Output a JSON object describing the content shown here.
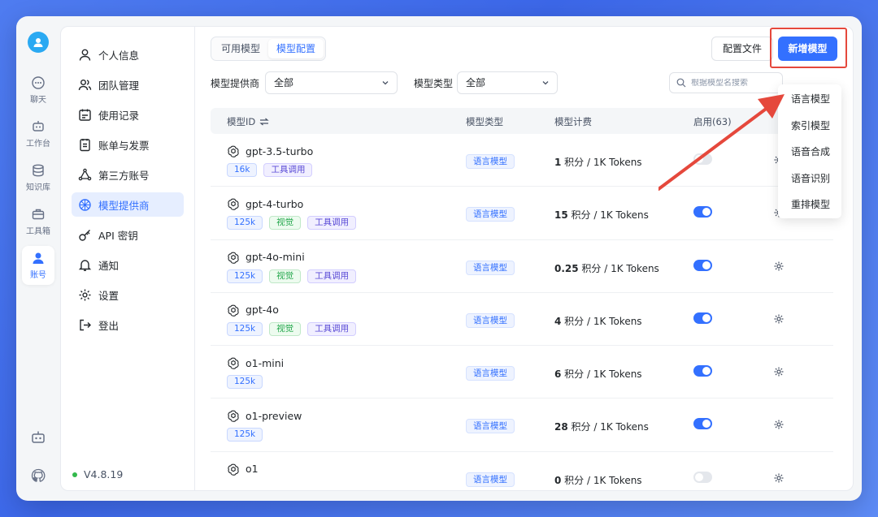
{
  "rail": {
    "items": [
      {
        "label": "聊天",
        "icon": "chat-icon"
      },
      {
        "label": "工作台",
        "icon": "robot-icon"
      },
      {
        "label": "知识库",
        "icon": "database-icon"
      },
      {
        "label": "工具箱",
        "icon": "toolbox-icon"
      },
      {
        "label": "账号",
        "icon": "user-icon"
      }
    ]
  },
  "menu": {
    "items": [
      {
        "label": "个人信息",
        "icon": "user-icon"
      },
      {
        "label": "团队管理",
        "icon": "team-icon"
      },
      {
        "label": "使用记录",
        "icon": "calendar-icon"
      },
      {
        "label": "账单与发票",
        "icon": "bill-icon"
      },
      {
        "label": "第三方账号",
        "icon": "share-icon"
      },
      {
        "label": "模型提供商",
        "icon": "model-icon"
      },
      {
        "label": "API 密钥",
        "icon": "key-icon"
      },
      {
        "label": "通知",
        "icon": "bell-icon"
      },
      {
        "label": "设置",
        "icon": "gear-icon"
      },
      {
        "label": "登出",
        "icon": "logout-icon"
      }
    ],
    "active_index": 5,
    "version": "V4.8.19"
  },
  "tabs": [
    "可用模型",
    "模型配置"
  ],
  "active_tab": 1,
  "buttons": {
    "config": "配置文件",
    "add": "新增模型"
  },
  "filters": {
    "provider_label": "模型提供商",
    "provider_value": "全部",
    "type_label": "模型类型",
    "type_value": "全部",
    "search_placeholder": "根据模型名搜索"
  },
  "table": {
    "headers": {
      "id": "模型ID",
      "type": "模型类型",
      "price": "模型计费",
      "enabled": "启用(63)"
    },
    "rows": [
      {
        "name": "gpt-3.5-turbo",
        "tags": [
          {
            "t": "16k",
            "c": "blue"
          },
          {
            "t": "工具调用",
            "c": "purple"
          }
        ],
        "type": "语言模型",
        "price_num": "1",
        "price_unit": " 积分 / 1K Tokens",
        "enabled": false
      },
      {
        "name": "gpt-4-turbo",
        "tags": [
          {
            "t": "125k",
            "c": "blue"
          },
          {
            "t": "视觉",
            "c": "green"
          },
          {
            "t": "工具调用",
            "c": "purple"
          }
        ],
        "type": "语言模型",
        "price_num": "15",
        "price_unit": " 积分 / 1K Tokens",
        "enabled": true
      },
      {
        "name": "gpt-4o-mini",
        "tags": [
          {
            "t": "125k",
            "c": "blue"
          },
          {
            "t": "视觉",
            "c": "green"
          },
          {
            "t": "工具调用",
            "c": "purple"
          }
        ],
        "type": "语言模型",
        "price_num": "0.25",
        "price_unit": " 积分 / 1K Tokens",
        "enabled": true
      },
      {
        "name": "gpt-4o",
        "tags": [
          {
            "t": "125k",
            "c": "blue"
          },
          {
            "t": "视觉",
            "c": "green"
          },
          {
            "t": "工具调用",
            "c": "purple"
          }
        ],
        "type": "语言模型",
        "price_num": "4",
        "price_unit": " 积分 / 1K Tokens",
        "enabled": true
      },
      {
        "name": "o1-mini",
        "tags": [
          {
            "t": "125k",
            "c": "blue"
          }
        ],
        "type": "语言模型",
        "price_num": "6",
        "price_unit": " 积分 / 1K Tokens",
        "enabled": true
      },
      {
        "name": "o1-preview",
        "tags": [
          {
            "t": "125k",
            "c": "blue"
          }
        ],
        "type": "语言模型",
        "price_num": "28",
        "price_unit": " 积分 / 1K Tokens",
        "enabled": true
      },
      {
        "name": "o1",
        "tags": [],
        "type": "语言模型",
        "price_num": "0",
        "price_unit": " 积分 / 1K Tokens",
        "enabled": false
      }
    ]
  },
  "dropdown": [
    "语言模型",
    "索引模型",
    "语音合成",
    "语音识别",
    "重排模型"
  ],
  "colors": {
    "accent": "#3370ff",
    "highlight": "#e5483c"
  }
}
